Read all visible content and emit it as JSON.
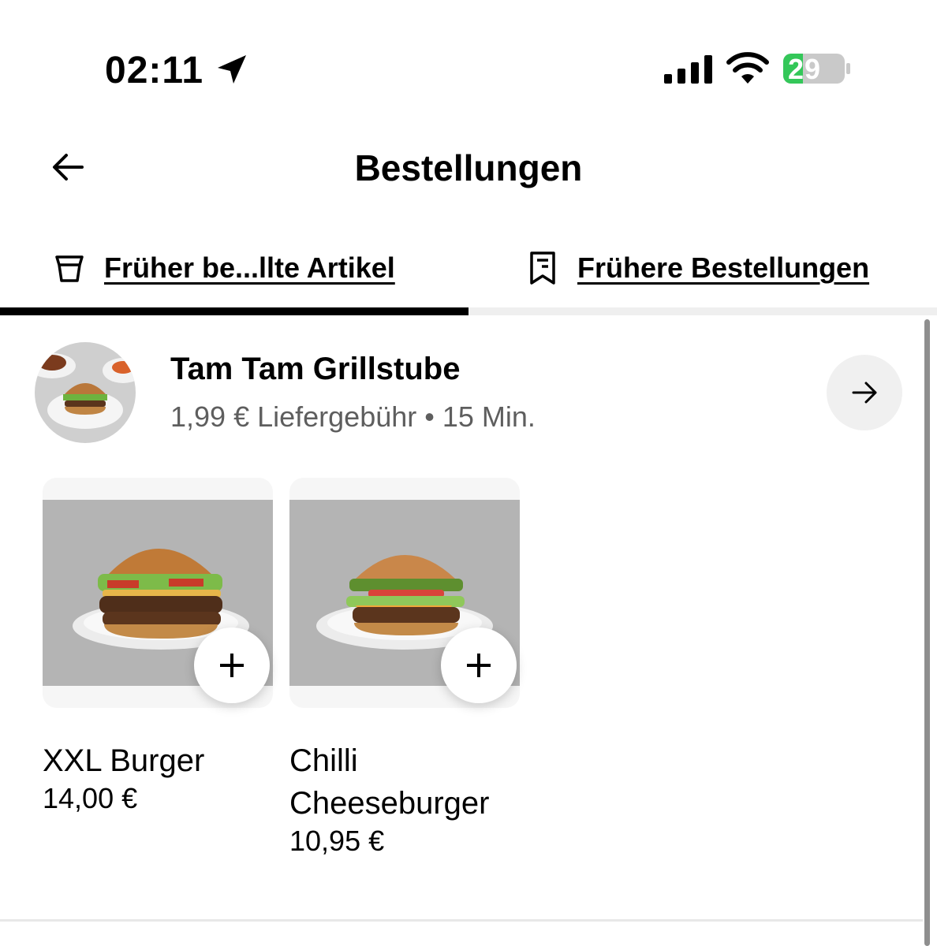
{
  "status_bar": {
    "time": "02:11",
    "battery": "29"
  },
  "header": {
    "title": "Bestellungen"
  },
  "tabs": [
    {
      "label": "Früher be...llte Artikel",
      "icon": "bag-icon",
      "active": true
    },
    {
      "label": "Frühere Bestellungen",
      "icon": "receipt-icon",
      "active": false
    }
  ],
  "store": {
    "name": "Tam Tam Grillstube",
    "meta": "1,99 € Liefergebühr • 15 Min."
  },
  "items": [
    {
      "name": "XXL Burger",
      "price": "14,00 €"
    },
    {
      "name": "Chilli Cheeseburger",
      "price": "10,95 €"
    }
  ],
  "colors": {
    "accent": "#000000",
    "battery_green": "#34c759",
    "secondary_text": "#5e5e5e"
  }
}
